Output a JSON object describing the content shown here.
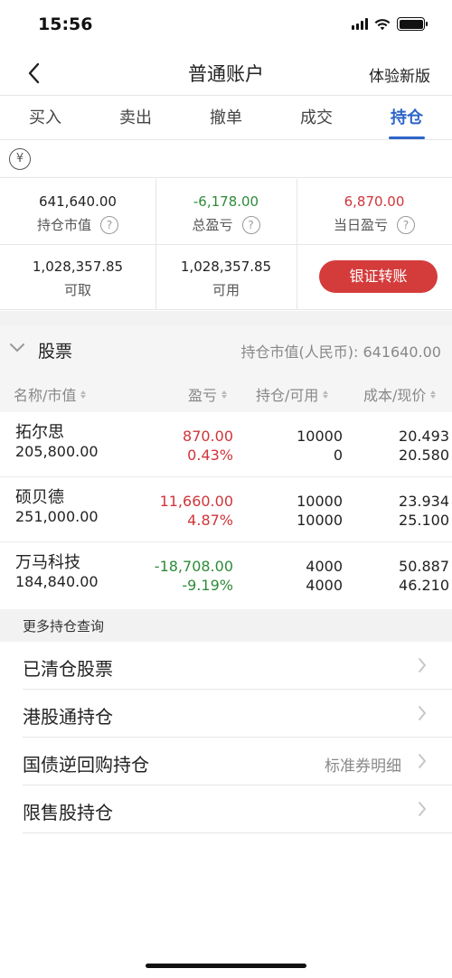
{
  "status_bar": {
    "time": "15:56"
  },
  "nav": {
    "title": "普通账户",
    "right_action": "体验新版"
  },
  "tabs": [
    "买入",
    "卖出",
    "撤单",
    "成交",
    "持仓"
  ],
  "active_tab": "持仓",
  "currency_symbol": "¥",
  "summary": {
    "market_value": {
      "value": "641,640.00",
      "label": "持仓市值"
    },
    "total_pnl": {
      "value": "-6,178.00",
      "label": "总盈亏"
    },
    "daily_pnl": {
      "value": "6,870.00",
      "label": "当日盈亏"
    },
    "withdrawable": {
      "value": "1,028,357.85",
      "label": "可取"
    },
    "available": {
      "value": "1,028,357.85",
      "label": "可用"
    },
    "transfer_button": "银证转账",
    "help_glyph": "?"
  },
  "stocks": {
    "section_title": "股票",
    "total_label": "持仓市值(人民币):  641640.00",
    "columns": [
      "名称/市值",
      "盈亏",
      "持仓/可用",
      "成本/现价"
    ],
    "rows": [
      {
        "name": "拓尔思",
        "market_value": "205,800.00",
        "pnl": "870.00",
        "pnl_pct": "0.43%",
        "position": "10000",
        "available": "0",
        "cost": "20.493",
        "price": "20.580",
        "pnl_color": "#d0353a"
      },
      {
        "name": "硕贝德",
        "market_value": "251,000.00",
        "pnl": "11,660.00",
        "pnl_pct": "4.87%",
        "position": "10000",
        "available": "10000",
        "cost": "23.934",
        "price": "25.100",
        "pnl_color": "#d0353a"
      },
      {
        "name": "万马科技",
        "market_value": "184,840.00",
        "pnl": "-18,708.00",
        "pnl_pct": "-9.19%",
        "position": "4000",
        "available": "4000",
        "cost": "50.887",
        "price": "46.210",
        "pnl_color": "#2e8b3a"
      }
    ]
  },
  "more": {
    "title": "更多持仓查询",
    "items": [
      {
        "label": "已清仓股票",
        "sub": ""
      },
      {
        "label": "港股通持仓",
        "sub": ""
      },
      {
        "label": "国债逆回购持仓",
        "sub": "标准券明细"
      },
      {
        "label": "限售股持仓",
        "sub": ""
      }
    ]
  },
  "colors": {
    "accent": "#2d64c8",
    "up": "#d0353a",
    "down": "#2e8b3a",
    "button": "#d43c3c"
  },
  "icons": [
    "back-chevron-icon",
    "signal-icon",
    "wifi-icon",
    "battery-icon",
    "yuan-icon",
    "help-icon",
    "collapse-chevron-icon",
    "sort-icon",
    "right-chevron-icon"
  ]
}
